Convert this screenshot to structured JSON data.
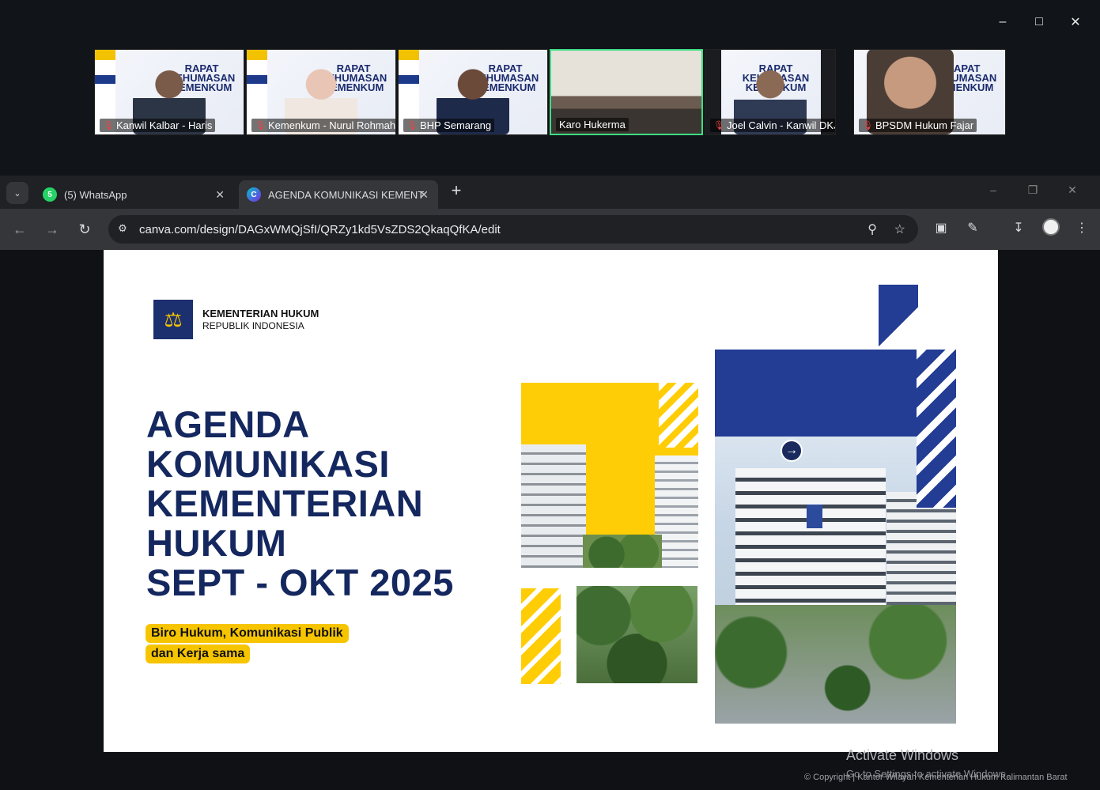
{
  "meeting": {
    "participants": [
      {
        "name": "Kanwil Kalbar - Haris",
        "muted": true
      },
      {
        "name": "Kemenkum - Nurul Rohmah",
        "muted": true
      },
      {
        "name": "BHP Semarang",
        "muted": true
      },
      {
        "name": "Karo Hukerma",
        "muted": false,
        "active": true
      },
      {
        "name": "Joel Calvin - Kanwil DKJ",
        "muted": true
      },
      {
        "name": "BPSDM Hukum Fajar",
        "muted": true
      }
    ],
    "tile_backdrop_text": "RAPAT KEHUMASAN KEMENKUM"
  },
  "browser": {
    "tabs": [
      {
        "label": "(5) WhatsApp",
        "badge": "5",
        "active": false
      },
      {
        "label": "AGENDA KOMUNIKASI KEMENT",
        "active": true
      }
    ],
    "url": "canva.com/design/DAGxWMQjSfI/QRZy1kd5VsZDS2QkaqQfKA/edit"
  },
  "slide": {
    "org_line1": "KEMENTERIAN HUKUM",
    "org_line2": "REPUBLIK INDONESIA",
    "title_lines": [
      "AGENDA",
      "KOMUNIKASI",
      "KEMENTERIAN",
      "HUKUM",
      "SEPT - OKT 2025"
    ],
    "subtitle_line1": "Biro Hukum, Komunikasi Publik",
    "subtitle_line2": "dan Kerja sama"
  },
  "watermark": {
    "activate_title": "Activate Windows",
    "activate_sub": "Go to Settings to activate Windows.",
    "copyright": "© Copyright | Kantor Wilayah Kementerian Hukum Kalimantan Barat"
  },
  "colors": {
    "accent_blue": "#14275f",
    "accent_yellow": "#f7c500",
    "active_border": "#3ddc84"
  }
}
